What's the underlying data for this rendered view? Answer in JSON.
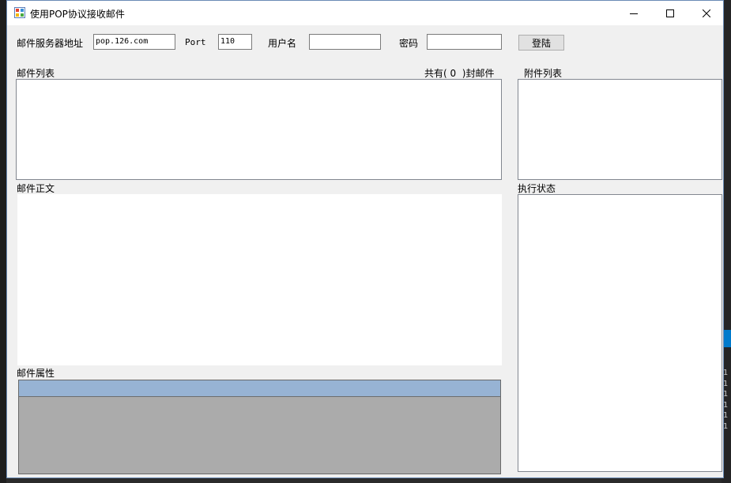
{
  "window": {
    "title": "使用POP协议接收邮件"
  },
  "form": {
    "server_label": "邮件服务器地址",
    "server_value": "pop.126.com",
    "port_label": "Port",
    "port_value": "110",
    "user_label": "用户名",
    "user_value": "",
    "password_label": "密码",
    "password_value": "",
    "login_label": "登陆"
  },
  "mail_list": {
    "label": "邮件列表",
    "count_prefix": "共有(",
    "count": "0",
    "count_suffix": ")封邮件"
  },
  "attachments": {
    "label": "附件列表"
  },
  "mail_body": {
    "label": "邮件正文"
  },
  "status": {
    "label": "执行状态"
  },
  "properties": {
    "label": "邮件属性"
  },
  "background": {
    "digits": [
      "1",
      "1",
      "1",
      "1",
      "1",
      "1"
    ]
  },
  "colors": {
    "grid_header": "#97b3d4",
    "grid_body": "#ababab",
    "ide_blue": "#007acc"
  }
}
